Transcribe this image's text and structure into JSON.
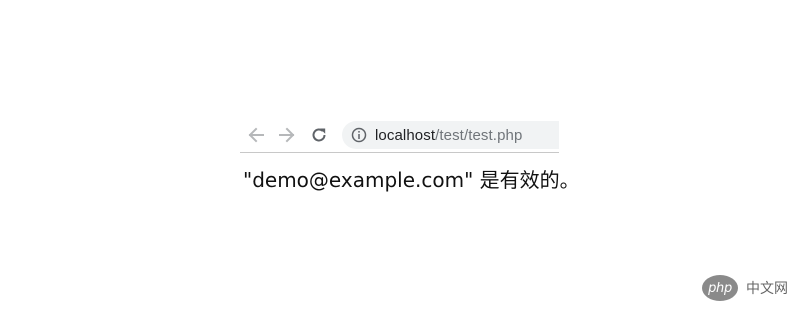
{
  "browser": {
    "icons": {
      "back": "arrow-left-icon",
      "forward": "arrow-right-icon",
      "reload": "reload-icon",
      "info": "info-icon"
    },
    "url": {
      "host": "localhost",
      "path": "/test/test.php"
    },
    "colors": {
      "nav_disabled": "#b6b8ba",
      "nav_active": "#5f6368",
      "omnibox_bg": "#f1f3f4"
    }
  },
  "page": {
    "result_text": "\"demo@example.com\" 是有效的。"
  },
  "watermark": {
    "logo_text": "php",
    "site_name": "中文网"
  }
}
